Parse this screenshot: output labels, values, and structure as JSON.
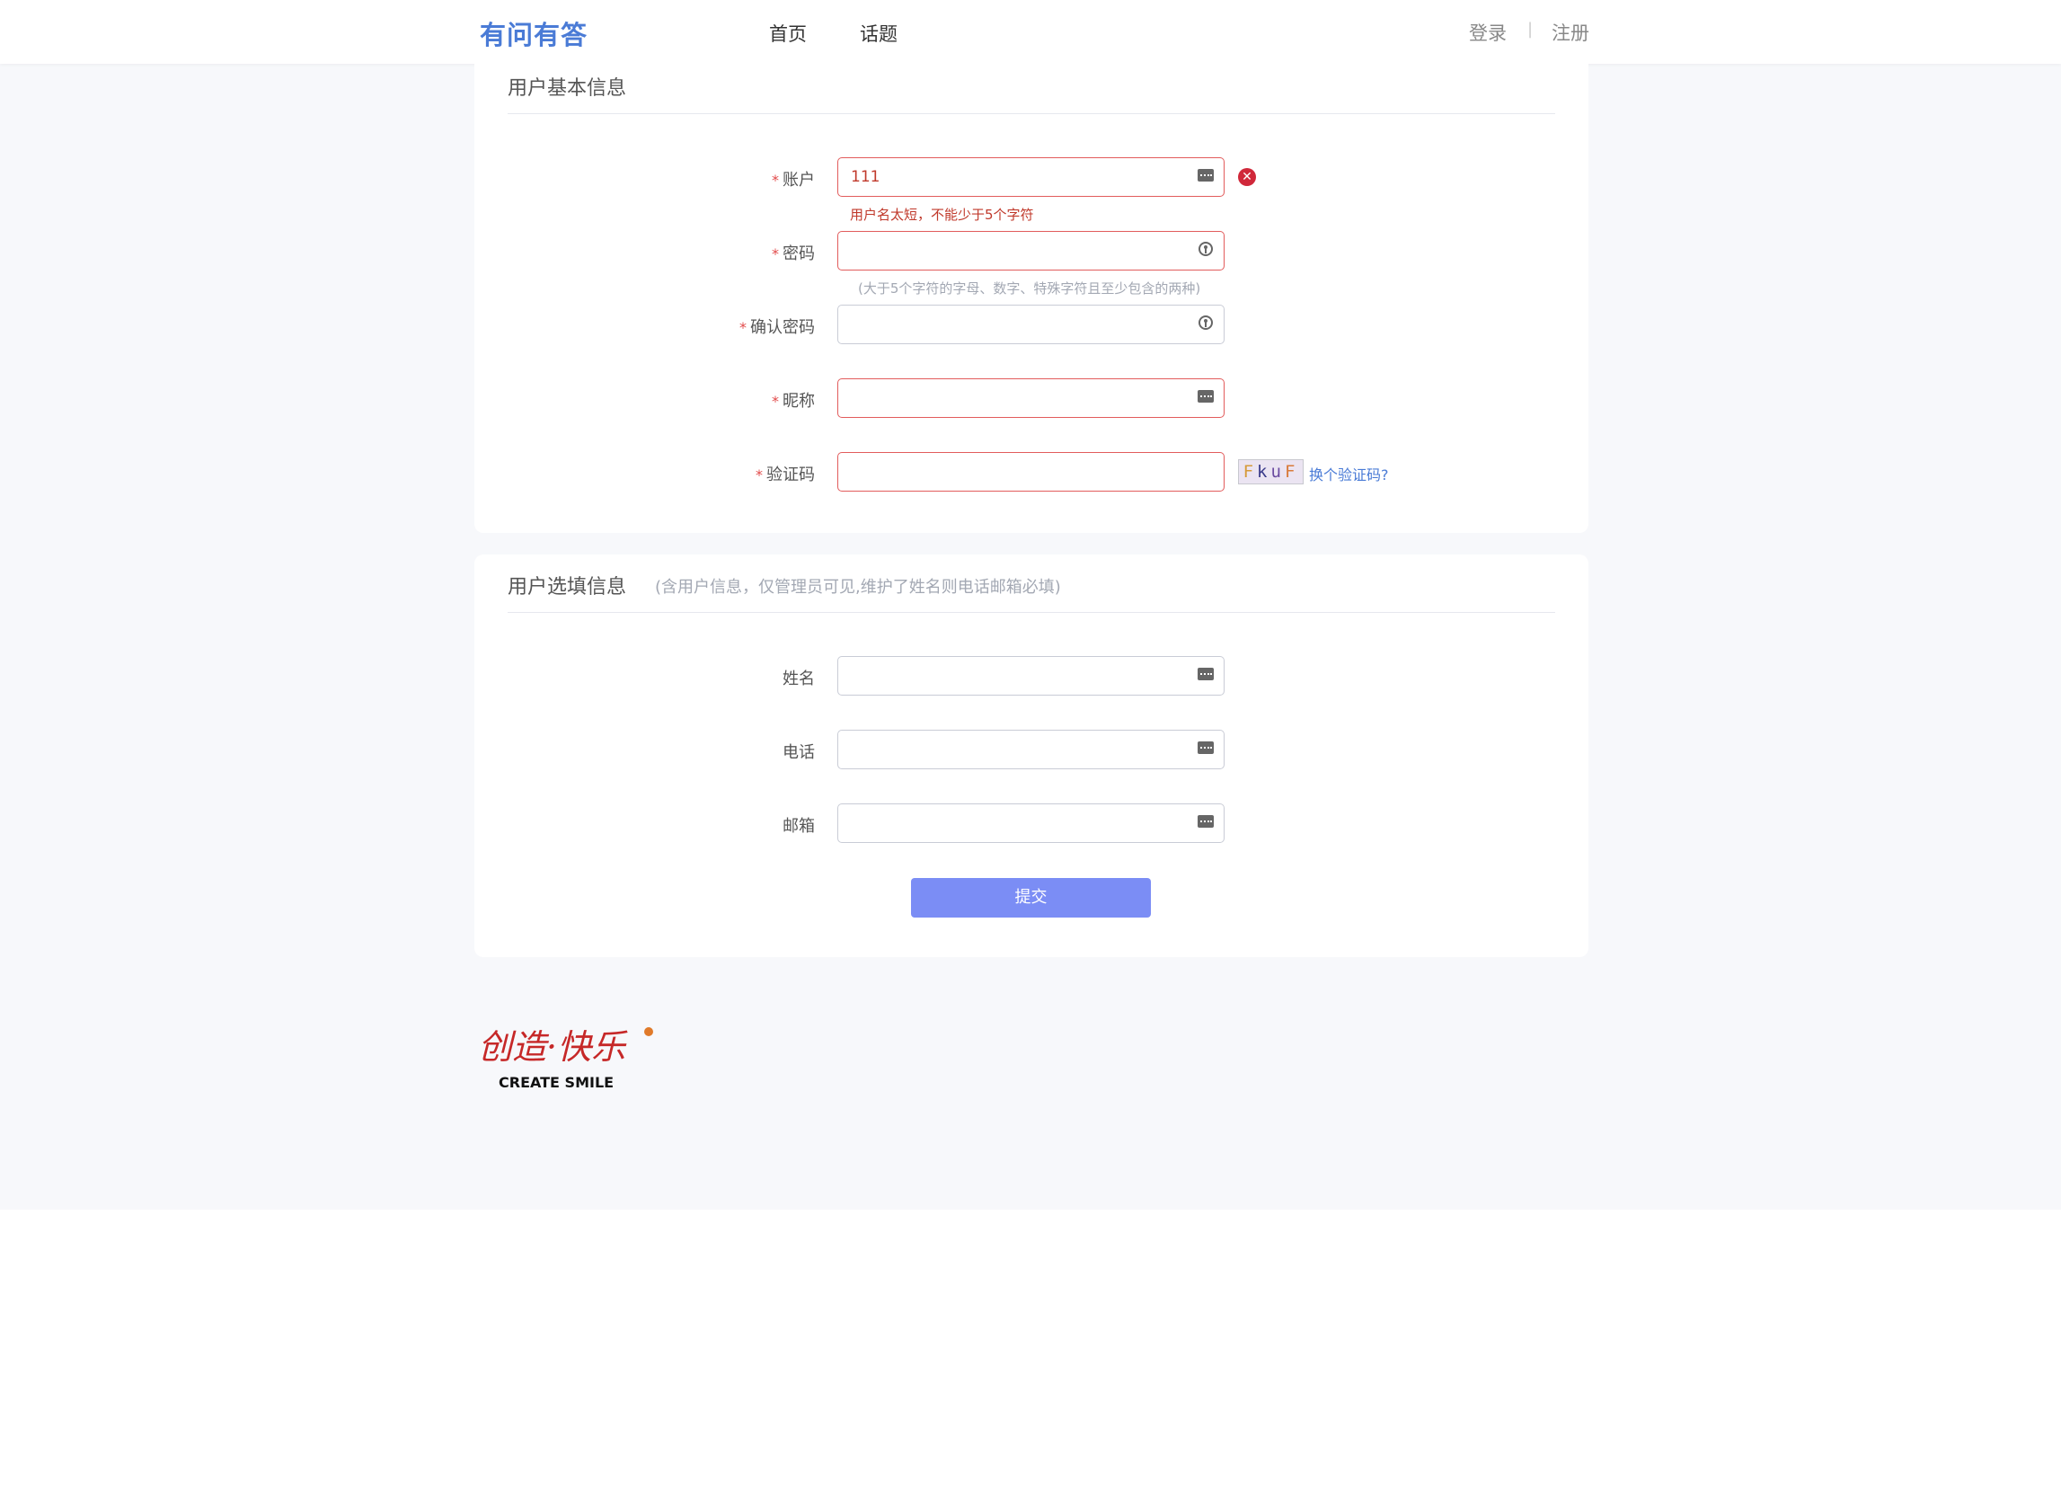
{
  "header": {
    "logo": "有问有答",
    "nav": [
      "首页",
      "话题"
    ],
    "login": "登录",
    "separator": "|",
    "register": "注册"
  },
  "basic": {
    "title": "用户基本信息",
    "account_label": "账户",
    "account_value": "111",
    "account_error": "用户名太短，不能少于5个字符",
    "password_label": "密码",
    "password_hint": "(大于5个字符的字母、数字、特殊字符且至少包含的两种)",
    "confirm_label": "确认密码",
    "nickname_label": "昵称",
    "captcha_label": "验证码",
    "captcha_chars": [
      "F",
      "k",
      "u",
      "F"
    ],
    "captcha_link": "换个验证码?",
    "required_mark": "*",
    "error_badge": "✕"
  },
  "optional": {
    "title": "用户选填信息",
    "subtitle": "(含用户信息，仅管理员可见,维护了姓名则电话邮箱必填)",
    "name_label": "姓名",
    "phone_label": "电话",
    "email_label": "邮箱",
    "submit": "提交"
  },
  "footer": {
    "brand_cn": "创造·快乐",
    "brand_en": "CREATE  SMILE"
  },
  "colors": {
    "accent": "#4a7bd6",
    "error": "#c0392b",
    "button": "#7b8df5"
  }
}
